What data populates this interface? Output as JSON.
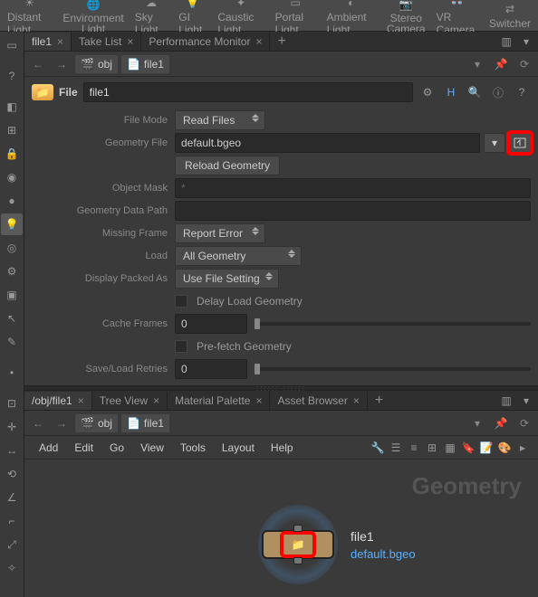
{
  "shelf": [
    {
      "id": "distant-light",
      "label": "Distant Light",
      "icon": "sun"
    },
    {
      "id": "env-light",
      "label": "Environment\nLight",
      "icon": "globe"
    },
    {
      "id": "sky-light",
      "label": "Sky Light",
      "icon": "sky"
    },
    {
      "id": "gi-light",
      "label": "GI Light",
      "icon": "bulb"
    },
    {
      "id": "caustic-light",
      "label": "Caustic Light",
      "icon": "spark"
    },
    {
      "id": "portal-light",
      "label": "Portal Light",
      "icon": "portal"
    },
    {
      "id": "ambient-light",
      "label": "Ambient Light",
      "icon": "ambient"
    },
    {
      "id": "stereo-cam",
      "label": "Stereo\nCamera",
      "icon": "cam"
    },
    {
      "id": "vr-cam",
      "label": "VR Camera",
      "icon": "vr"
    },
    {
      "id": "switcher",
      "label": "Switcher",
      "icon": "switch"
    }
  ],
  "upper_tabs": {
    "tabs": [
      {
        "label": "file1",
        "active": true
      },
      {
        "label": "Take List",
        "active": false
      },
      {
        "label": "Performance Monitor",
        "active": false
      }
    ]
  },
  "upper_path": {
    "context": "obj",
    "node": "file1"
  },
  "node_header": {
    "type_label": "File",
    "name": "file1"
  },
  "params": {
    "file_mode_label": "File Mode",
    "file_mode_value": "Read Files",
    "geometry_file_label": "Geometry File",
    "geometry_file_value": "default.bgeo",
    "reload_label": "Reload Geometry",
    "object_mask_label": "Object Mask",
    "object_mask_value": "*",
    "geo_data_path_label": "Geometry Data Path",
    "geo_data_path_value": "",
    "missing_frame_label": "Missing Frame",
    "missing_frame_value": "Report Error",
    "load_label": "Load",
    "load_value": "All Geometry",
    "display_packed_label": "Display Packed As",
    "display_packed_value": "Use File Setting",
    "delay_load_label": "Delay Load Geometry",
    "cache_frames_label": "Cache Frames",
    "cache_frames_value": "0",
    "prefetch_label": "Pre-fetch Geometry",
    "save_retries_label": "Save/Load Retries",
    "save_retries_value": "0"
  },
  "lower_tabs": {
    "tabs": [
      {
        "label": "/obj/file1",
        "active": true
      },
      {
        "label": "Tree View",
        "active": false
      },
      {
        "label": "Material Palette",
        "active": false
      },
      {
        "label": "Asset Browser",
        "active": false
      }
    ]
  },
  "lower_path": {
    "context": "obj",
    "node": "file1"
  },
  "menu": {
    "items": [
      "Add",
      "Edit",
      "Go",
      "View",
      "Tools",
      "Layout",
      "Help"
    ]
  },
  "network": {
    "watermark": "Geometry",
    "node_name": "file1",
    "node_file": "default.bgeo"
  }
}
